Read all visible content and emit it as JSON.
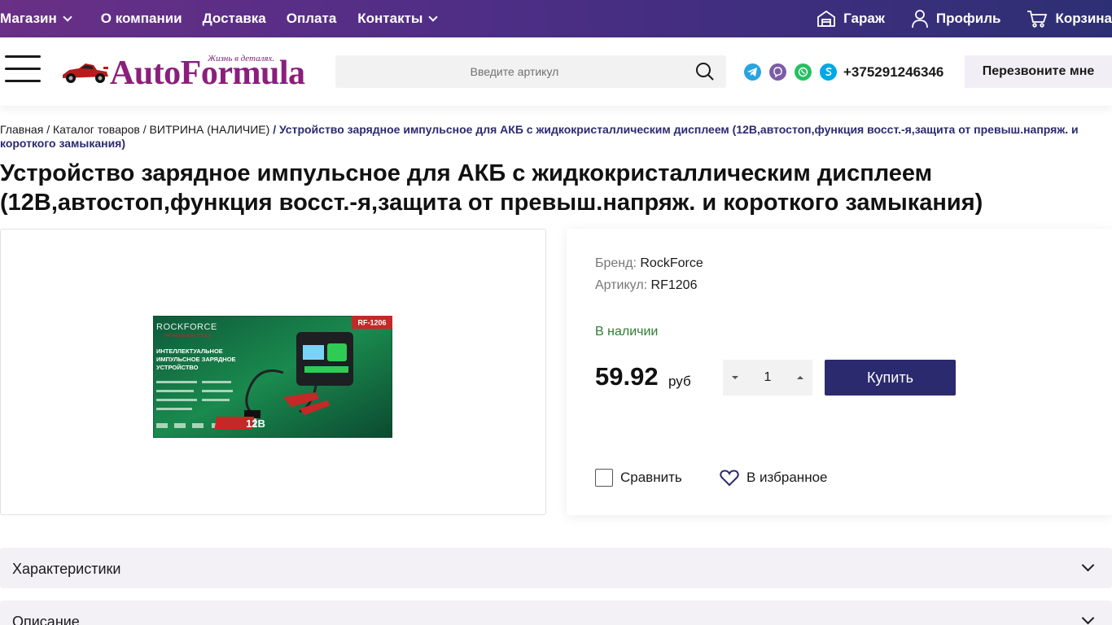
{
  "top_nav": {
    "items": [
      {
        "label": "Магазин",
        "dropdown": true
      },
      {
        "label": "О компании",
        "dropdown": false
      },
      {
        "label": "Доставка",
        "dropdown": false
      },
      {
        "label": "Оплата",
        "dropdown": false
      },
      {
        "label": "Контакты",
        "dropdown": true
      }
    ],
    "right": {
      "garage": "Гараж",
      "profile": "Профиль",
      "cart": "Корзина"
    }
  },
  "header": {
    "logo_text": "AutoFormula",
    "logo_slogan": "Жизнь в деталях.",
    "search_placeholder": "Введите артикул",
    "phone": "+375291246346",
    "callback_label": "Перезвоните мне"
  },
  "breadcrumb": {
    "items": [
      "Главная",
      "Каталог товаров",
      "ВИТРИНА (НАЛИЧИЕ)"
    ],
    "separator": "/",
    "current": "Устройство зарядное импульсное для АКБ с жидкокристаллическим дисплеем (12В,автостоп,функция восст.-я,защита от превыш.напряж. и короткого замыкания)"
  },
  "product": {
    "title": "Устройство зарядное импульсное для АКБ с жидкокристаллическим дисплеем (12В,автостоп,функция восст.-я,защита от превыш.напряж. и короткого замыкания)",
    "brand_label": "Бренд:",
    "brand": "RockForce",
    "sku_label": "Артикул:",
    "sku": "RF1206",
    "stock": "В наличии",
    "price": "59.92",
    "currency": "руб",
    "quantity": "1",
    "buy_label": "Купить",
    "compare_label": "Сравнить",
    "favorite_label": "В избранное",
    "image": {
      "brand_text": "ROCKFORCE",
      "sub_text": "PROFESSIONAL TOOLS",
      "model_badge": "RF-1206",
      "headline_1": "ИНТЕЛЛЕКТУАЛЬНОЕ",
      "headline_2": "ИМПУЛЬСНОЕ ЗАРЯДНОЕ",
      "headline_3": "УСТРОЙСТВО",
      "voltage": "12В"
    }
  },
  "accordion": [
    {
      "label": "Характеристики"
    },
    {
      "label": "Описание"
    }
  ],
  "colors": {
    "top_bar_start": "#6a2f86",
    "top_bar_end": "#2d2f74",
    "buy_button": "#2b2a6e",
    "in_stock": "#2e7d32",
    "logo": "#8a1f7c"
  }
}
